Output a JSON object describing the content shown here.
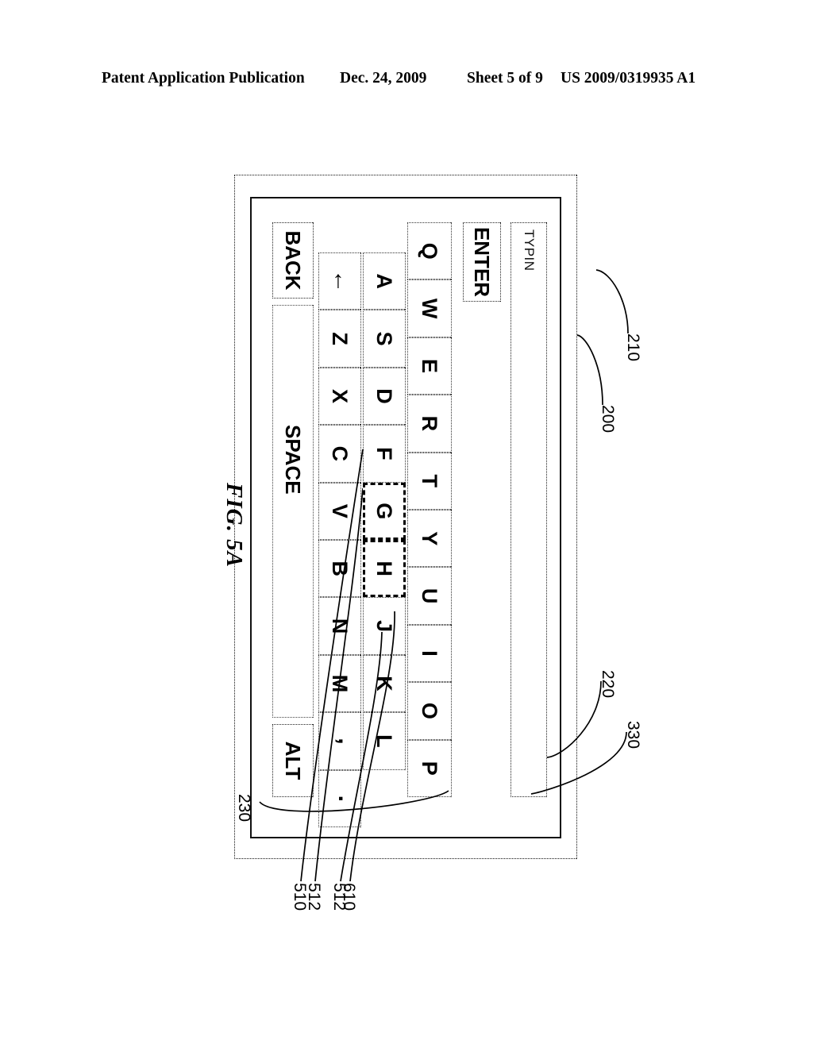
{
  "page_header": {
    "publication": "Patent Application Publication",
    "date": "Dec. 24, 2009",
    "sheet": "Sheet 5 of 9",
    "number": "US 2009/0319935 A1"
  },
  "figure": {
    "caption": "FIG. 5A",
    "orientation_deg": 90,
    "device": {
      "outer_frame_style": "dotted",
      "inner_frame_style": "solid"
    },
    "display_field": {
      "value": "TYPIN",
      "placeholder": ""
    },
    "enter_key": {
      "label": "ENTER"
    },
    "keyboard": {
      "row1": [
        "Q",
        "W",
        "E",
        "R",
        "T",
        "Y",
        "U",
        "I",
        "O",
        "P"
      ],
      "row2": [
        "A",
        "S",
        "D",
        "F",
        "G",
        "H",
        "J",
        "K",
        "L"
      ],
      "row3": [
        "←",
        "Z",
        "X",
        "C",
        "V",
        "B",
        "N",
        "M",
        ",",
        "."
      ],
      "highlighted_keys": [
        "G",
        "H"
      ],
      "shift_icon": "left-arrow-icon"
    },
    "function_row": [
      {
        "label": "BACK"
      },
      {
        "label": "SPACE"
      },
      {
        "label": "ALT"
      }
    ],
    "reference_numerals": [
      {
        "id": "200",
        "target": "device-outer-frame"
      },
      {
        "id": "210",
        "target": "enter-key"
      },
      {
        "id": "220",
        "target": "display-field"
      },
      {
        "id": "230",
        "target": "keyboard"
      },
      {
        "id": "330",
        "target": "typed-text"
      },
      {
        "id": "510",
        "target": "key-f-boundary"
      },
      {
        "id": "512",
        "target": "highlight-g"
      },
      {
        "id": "512b",
        "label": "512",
        "target": "highlight-h"
      },
      {
        "id": "610",
        "target": "key-j-boundary"
      }
    ]
  }
}
